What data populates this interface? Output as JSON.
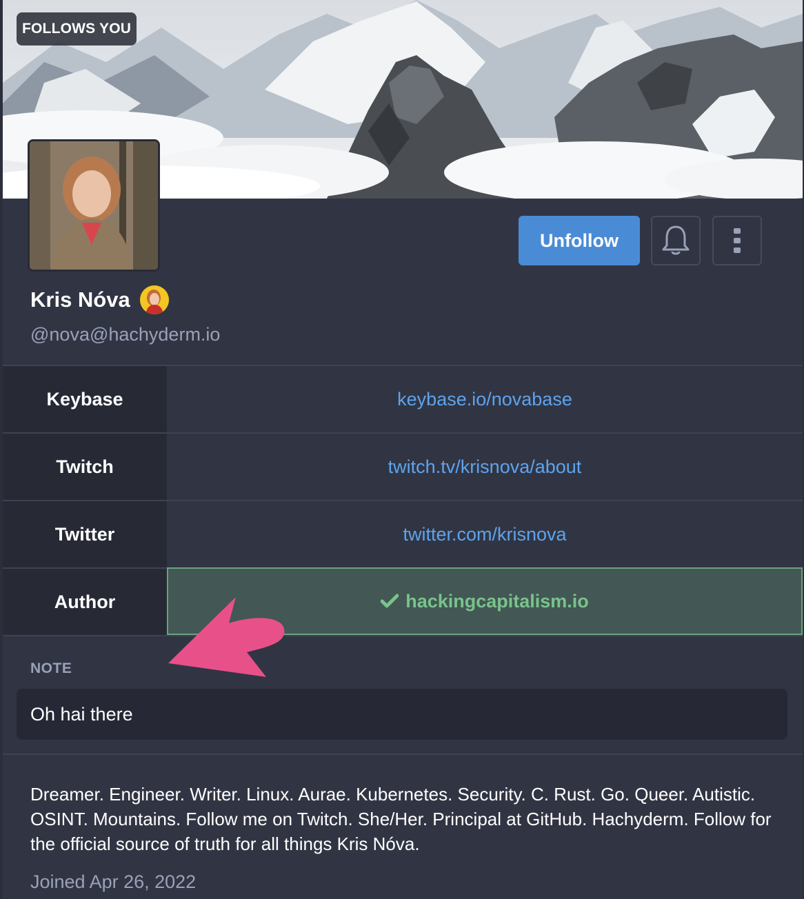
{
  "header": {
    "follows_badge": "FOLLOWS YOU"
  },
  "profile": {
    "display_name": "Kris Nóva",
    "handle": "@nova@hachyderm.io"
  },
  "actions": {
    "unfollow_label": "Unfollow",
    "bell_icon": "bell-icon",
    "more_icon": "more-vertical-icon"
  },
  "fields": [
    {
      "name": "Keybase",
      "value": "keybase.io/novabase",
      "verified": false
    },
    {
      "name": "Twitch",
      "value": "twitch.tv/krisnova/about",
      "verified": false
    },
    {
      "name": "Twitter",
      "value": "twitter.com/krisnova",
      "verified": false
    },
    {
      "name": "Author",
      "value": "hackingcapitalism.io",
      "verified": true
    }
  ],
  "note": {
    "label": "NOTE",
    "value": "Oh hai there"
  },
  "bio": "Dreamer. Engineer. Writer. Linux. Aurae. Kubernetes. Security. C. Rust. Go. Queer. Autistic. OSINT. Mountains. Follow me on Twitch. She/Her. Principal at GitHub. Hachyderm. Follow for the official source of truth for all things Kris Nóva.",
  "joined": "Joined Apr 26, 2022",
  "colors": {
    "accent": "#4a8bd6",
    "link": "#5ea3ee",
    "verified": "#79c38d",
    "annotation_arrow": "#e8508a"
  }
}
